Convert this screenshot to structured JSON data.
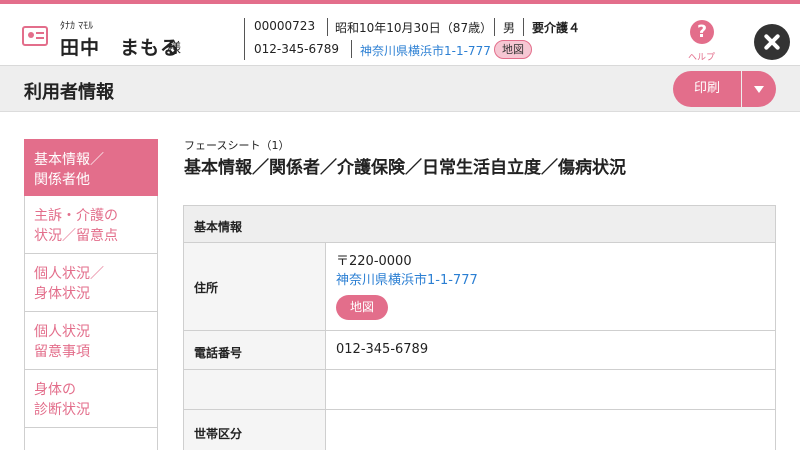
{
  "header": {
    "furigana": "ﾀﾅｶ ﾏﾓﾙ",
    "name": "田中　まもる",
    "name_suffix": "様",
    "user_id": "00000723",
    "birthdate": "昭和10年10月30日（87歳）",
    "gender": "男",
    "care_level": "要介護４",
    "phone": "012-345-6789",
    "address": "神奈川県横浜市1-1-777",
    "map_label": "地図",
    "help_icon": "?",
    "help_label": "ヘルプ"
  },
  "titlebar": {
    "title": "利用者情報",
    "print_label": "印刷"
  },
  "sidebar": {
    "items": [
      {
        "label": "基本情報／関係者他",
        "line1": "基本情報／",
        "line2": "関係者他",
        "active": true
      },
      {
        "label": "主訴・介護の状況／留意点",
        "line1": "主訴・介護の",
        "line2": "状況／留意点",
        "active": false
      },
      {
        "label": "個人状況／身体状況",
        "line1": "個人状況／",
        "line2": "身体状況",
        "active": false
      },
      {
        "label": "個人状況留意事項",
        "line1": "個人状況",
        "line2": "留意事項",
        "active": false
      },
      {
        "label": "身体の診断状況",
        "line1": "身体の",
        "line2": "診断状況",
        "active": false
      }
    ]
  },
  "main": {
    "subtitle": "フェースシート（1）",
    "title": "基本情報／関係者／介護保険／日常生活自立度／傷病状況",
    "section_header": "基本情報",
    "rows": {
      "address_label": "住所",
      "postal_code": "〒220-0000",
      "address": "神奈川県横浜市1-1-777",
      "map_label": "地図",
      "phone_label": "電話番号",
      "phone": "012-345-6789",
      "empty_label": "",
      "household_label": "世帯区分",
      "household_value": ""
    }
  },
  "colors": {
    "accent": "#e36e8b",
    "link": "#2b7fd3",
    "titlebar_bg": "#eeeeee"
  }
}
